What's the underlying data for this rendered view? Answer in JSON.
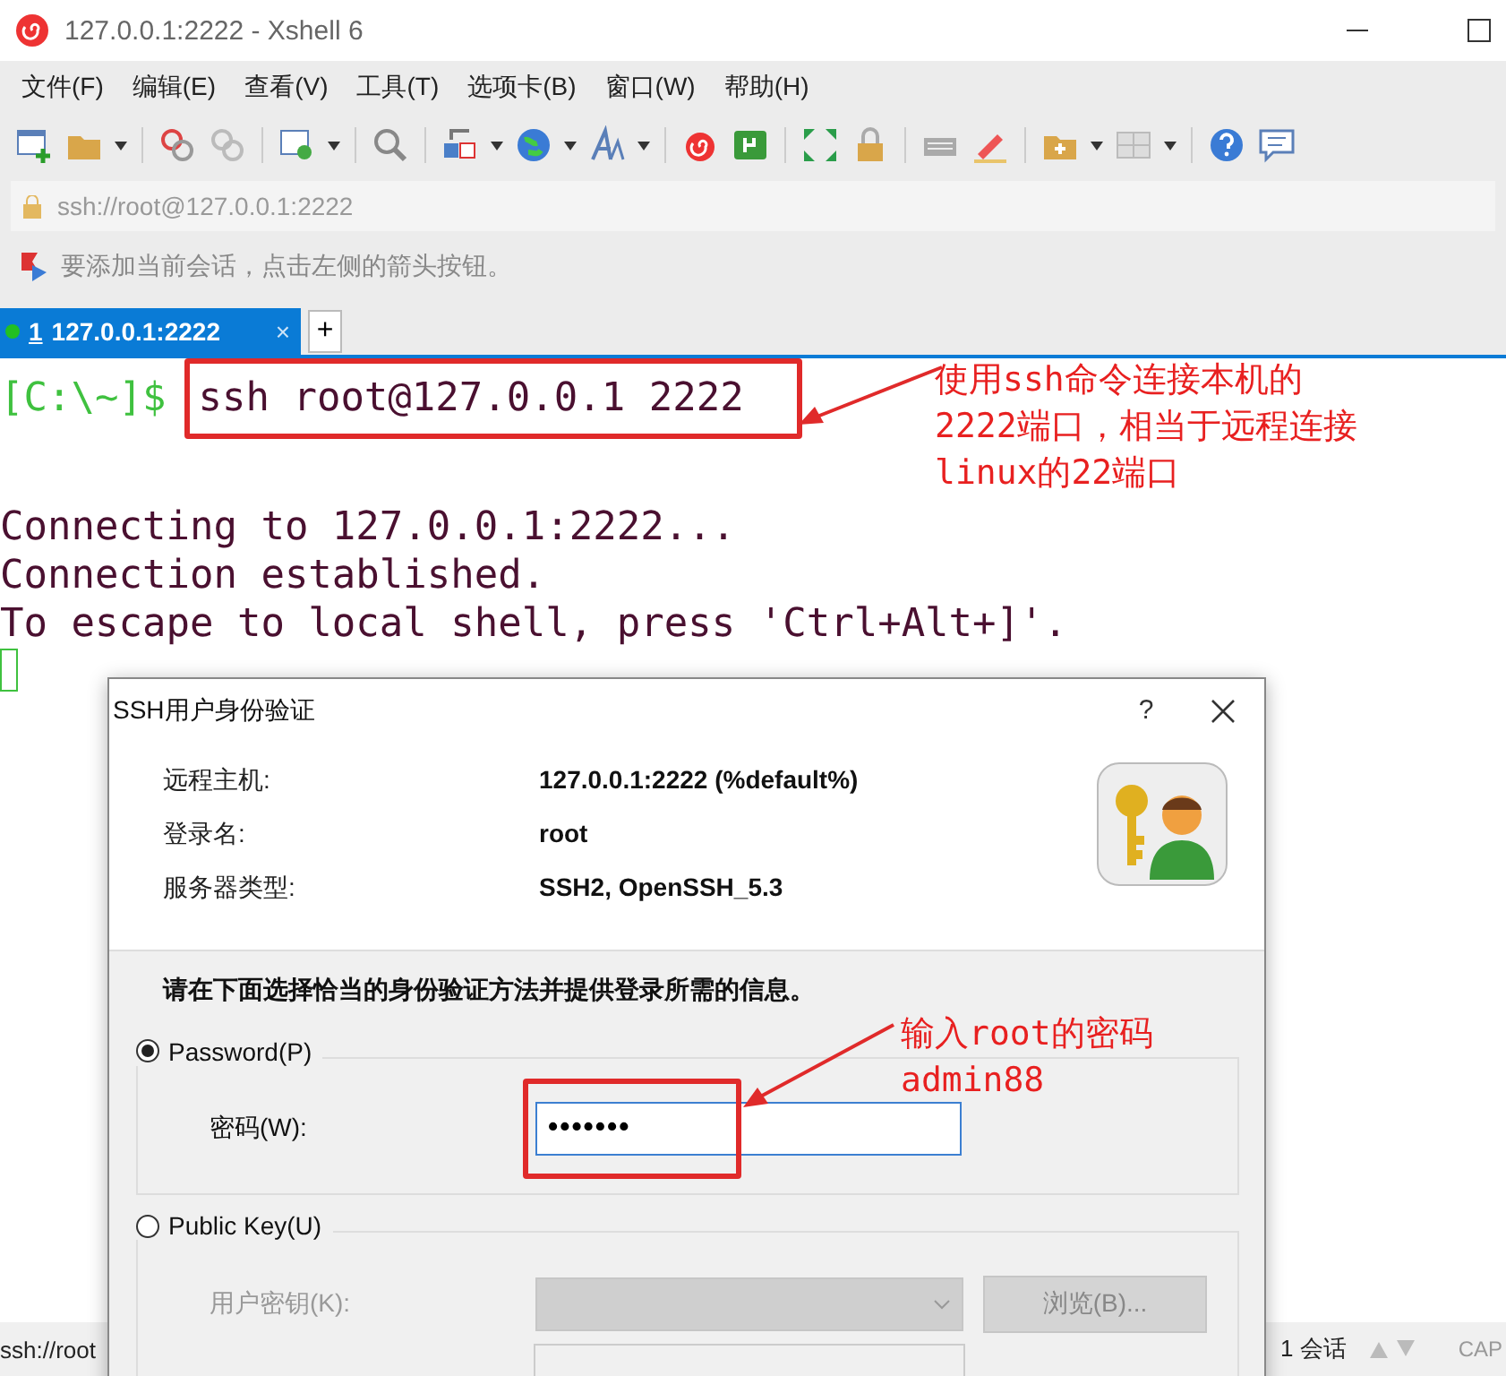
{
  "window": {
    "title": "127.0.0.1:2222 - Xshell 6"
  },
  "menu": [
    "文件(F)",
    "编辑(E)",
    "查看(V)",
    "工具(T)",
    "选项卡(B)",
    "窗口(W)",
    "帮助(H)"
  ],
  "address": "ssh://root@127.0.0.1:2222",
  "hint": "要添加当前会话，点击左侧的箭头按钮。",
  "tabs": [
    {
      "number": "1",
      "label": "127.0.0.1:2222",
      "close": "×",
      "selected": true
    }
  ],
  "new_tab": "+",
  "terminal": {
    "prompt": "[C:\\~]$",
    "command": "ssh root@127.0.0.1 2222",
    "output": [
      "Connecting to 127.0.0.1:2222...",
      "Connection established.",
      "To escape to local shell, press 'Ctrl+Alt+]'."
    ]
  },
  "annotations": [
    {
      "lines": [
        "使用ssh命令连接本机的",
        "2222端口，相当于远程连接",
        "linux的22端口"
      ]
    },
    {
      "lines": [
        "输入root的密码",
        "admin88"
      ]
    }
  ],
  "status_bar": {
    "left": "ssh://root",
    "sessions": "1 会话",
    "caps": "CAP"
  },
  "dialog": {
    "title": "SSH用户身份验证",
    "help": "?",
    "info": [
      {
        "label": "远程主机:",
        "value": "127.0.0.1:2222 (%default%)"
      },
      {
        "label": "登录名:",
        "value": "root"
      },
      {
        "label": "服务器类型:",
        "value": "SSH2, OpenSSH_5.3"
      }
    ],
    "instruction": "请在下面选择恰当的身份验证方法并提供登录所需的信息。",
    "methods": [
      {
        "kind": "password",
        "label": "Password(P)",
        "selected": true,
        "disabled": false,
        "field_label": "密码(W):",
        "value": "•••••••"
      },
      {
        "kind": "public_key",
        "label": "Public Key(U)",
        "selected": false,
        "disabled": true,
        "field_label": "用户密钥(K):",
        "button": "浏览(B)..."
      }
    ]
  }
}
